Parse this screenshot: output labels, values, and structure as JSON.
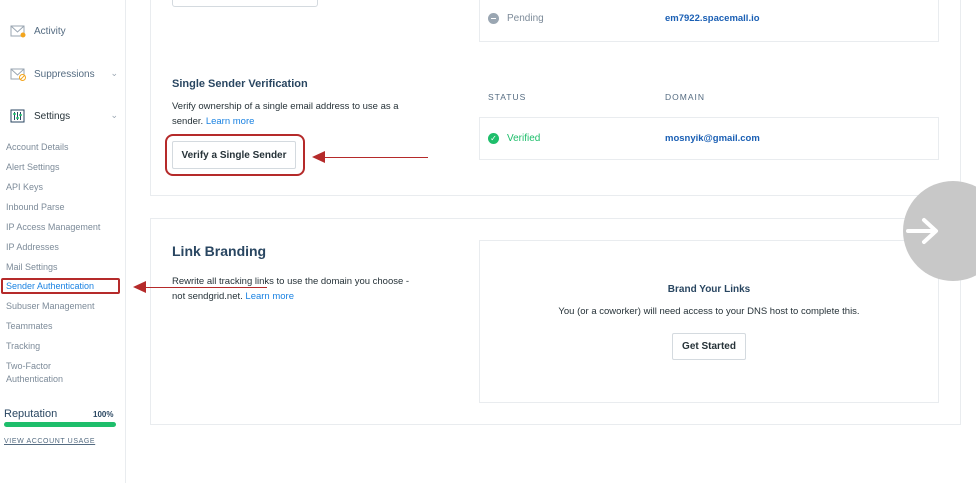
{
  "sidebar": {
    "sections": [
      {
        "label": "Activity",
        "icon": "activity-icon"
      },
      {
        "label": "Suppressions",
        "icon": "suppressions-icon"
      },
      {
        "label": "Settings",
        "icon": "settings-icon"
      }
    ],
    "settings_items": [
      "Account Details",
      "Alert Settings",
      "API Keys",
      "Inbound Parse",
      "IP Access Management",
      "IP Addresses",
      "Mail Settings",
      "Sender Authentication",
      "Subuser Management",
      "Teammates",
      "Tracking",
      "Two-Factor",
      "Authentication"
    ],
    "reputation": {
      "label": "Reputation",
      "value": "100%",
      "fraction": 1.0
    },
    "view_usage": "VIEW ACCOUNT USAGE"
  },
  "domain_auth": {
    "pending_status": "Pending",
    "pending_domain": "em7922.spacemall.io"
  },
  "single_sender": {
    "title": "Single Sender Verification",
    "desc": "Verify ownership of a single email address to use as a sender.",
    "learn_more": "Learn more",
    "button": "Verify a Single Sender",
    "col_status": "STATUS",
    "col_domain": "DOMAIN",
    "status": "Verified",
    "email": "mosnyik@gmail.com"
  },
  "link_branding": {
    "title": "Link Branding",
    "desc_line1": "Rewrite all tracking links to use the domain you choose -",
    "desc_line2": "not sendgrid.net.",
    "learn_more": "Learn more",
    "brand_title": "Brand Your Links",
    "brand_desc": "You (or a coworker) will need access to your DNS host to complete this.",
    "button": "Get Started"
  },
  "colors": {
    "accent": "#1a82e2",
    "verified": "#1ebe6b",
    "annotation": "#b52a2a"
  }
}
